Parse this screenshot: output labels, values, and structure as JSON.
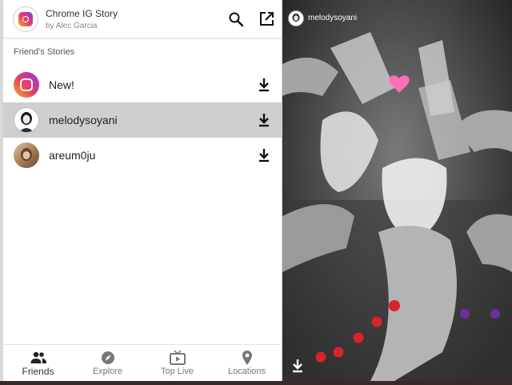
{
  "header": {
    "title": "Chrome IG Story",
    "author": "by Alec Garcia",
    "search_icon": "search-icon",
    "open_icon": "open-in-new-icon"
  },
  "section": {
    "label": "Friend's Stories"
  },
  "stories": [
    {
      "name": "New!",
      "avatar": "instagram-icon",
      "selected": false
    },
    {
      "name": "melodysoyani",
      "avatar": "user-avatar",
      "selected": true
    },
    {
      "name": "areum0ju",
      "avatar": "user-avatar",
      "selected": false
    }
  ],
  "nav": {
    "items": [
      {
        "label": "Friends",
        "icon": "people-icon",
        "active": true
      },
      {
        "label": "Explore",
        "icon": "compass-icon",
        "active": false
      },
      {
        "label": "Top Live",
        "icon": "live-tv-icon",
        "active": false
      },
      {
        "label": "Locations",
        "icon": "location-pin-icon",
        "active": false
      }
    ]
  },
  "viewer": {
    "owner": "melodysoyani",
    "download_icon": "download-icon"
  },
  "colors": {
    "selected_row": "#cfcfcf",
    "text_primary": "#222222",
    "text_secondary": "#888888",
    "icon": "#111111"
  }
}
